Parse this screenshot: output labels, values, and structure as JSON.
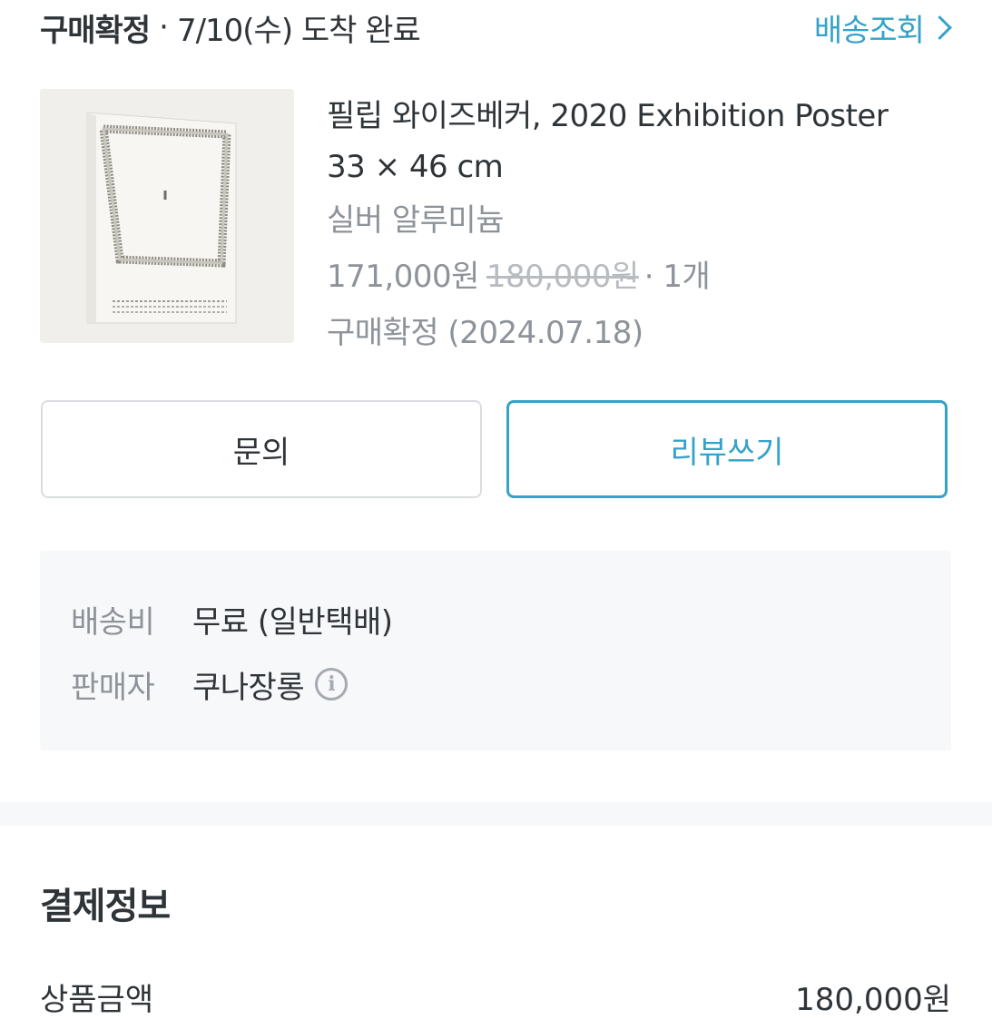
{
  "status": {
    "label": "구매확정",
    "separator": "·",
    "arrival": "7/10(수) 도착 완료",
    "track_link": "배송조회"
  },
  "product": {
    "title_line1": "필립 와이즈베커, 2020 Exhibition Poster",
    "title_line2": "33 × 46 cm",
    "option": "실버 알루미늄",
    "price": "171,000원",
    "original_price": "180,000원",
    "qty": "· 1개",
    "confirm": "구매확정 (2024.07.18)"
  },
  "buttons": {
    "inquiry": "문의",
    "review": "리뷰쓰기"
  },
  "shipping": {
    "fee_label": "배송비",
    "fee_value": "무료 (일반택배)",
    "seller_label": "판매자",
    "seller_value": "쿠나장롱"
  },
  "payment": {
    "title": "결제정보",
    "item_label": "상품금액",
    "item_value": "180,000원"
  },
  "colors": {
    "accent": "#35a2c9",
    "text": "#2f3438",
    "muted": "#8d9399",
    "panel": "#f7f8fa"
  }
}
